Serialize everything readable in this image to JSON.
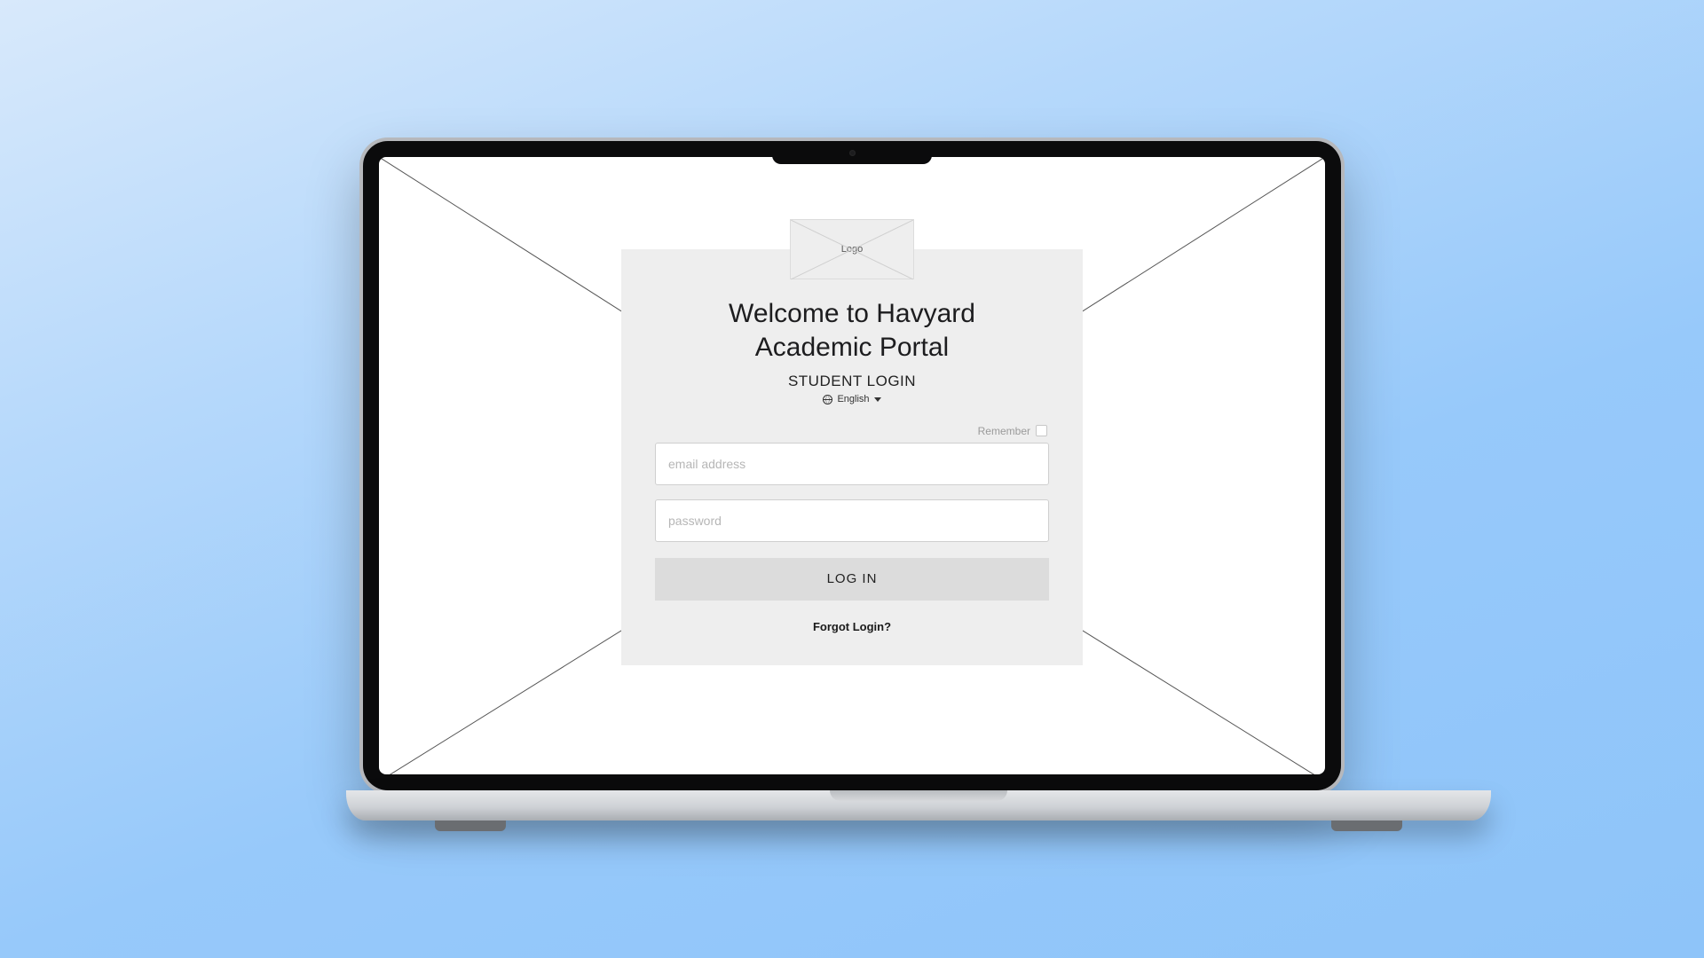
{
  "logo": {
    "placeholder_label": "Logo"
  },
  "heading": {
    "title_line1": "Welcome to Havyard",
    "title_line2": "Academic Portal",
    "subtitle": "STUDENT LOGIN"
  },
  "language": {
    "selected": "English"
  },
  "remember": {
    "label": "Remember"
  },
  "fields": {
    "email_placeholder": "email address",
    "password_placeholder": "password"
  },
  "buttons": {
    "login": "LOG IN",
    "forgot": "Forgot Login?"
  }
}
